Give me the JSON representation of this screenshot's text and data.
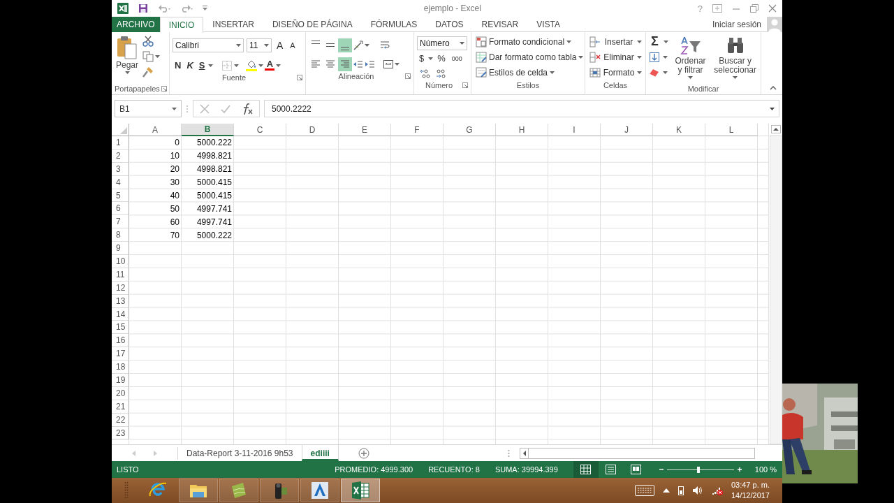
{
  "window": {
    "title": "ejemplo - Excel",
    "help": "?"
  },
  "tabs": [
    {
      "label": "ARCHIVO",
      "kind": "file",
      "selected": false
    },
    {
      "label": "INICIO",
      "kind": "tab",
      "selected": true
    },
    {
      "label": "INSERTAR",
      "kind": "tab",
      "selected": false
    },
    {
      "label": "DISEÑO DE PÁGINA",
      "kind": "tab",
      "selected": false
    },
    {
      "label": "FÓRMULAS",
      "kind": "tab",
      "selected": false
    },
    {
      "label": "DATOS",
      "kind": "tab",
      "selected": false
    },
    {
      "label": "REVISAR",
      "kind": "tab",
      "selected": false
    },
    {
      "label": "VISTA",
      "kind": "tab",
      "selected": false
    }
  ],
  "account": "Iniciar sesión",
  "ribbon": {
    "clipboard": {
      "paste": "Pegar",
      "label": "Portapapeles"
    },
    "font": {
      "name": "Calibri",
      "size": "11",
      "grow": "A",
      "shrink": "A",
      "styles": [
        "N",
        "K",
        "S"
      ],
      "color_button": "A",
      "label": "Fuente"
    },
    "alignment": {
      "vertical": [
        {
          "selected": false
        },
        {
          "selected": false
        },
        {
          "selected": true
        }
      ],
      "horizontal": [
        {
          "selected": false
        },
        {
          "selected": false
        },
        {
          "selected": true
        }
      ],
      "label": "Alineación"
    },
    "number": {
      "format": "Número",
      "currency": "$",
      "percent": "%",
      "thousands": "000",
      "label": "Número"
    },
    "styles": {
      "items": [
        "Formato condicional",
        "Dar formato como tabla",
        "Estilos de celda"
      ],
      "label": "Estilos"
    },
    "cells": {
      "items": [
        "Insertar",
        "Eliminar",
        "Formato"
      ],
      "label": "Celdas"
    },
    "editing": {
      "sum": "Σ",
      "sort": "Ordenar y filtrar",
      "find": "Buscar y seleccionar",
      "label": "Modificar"
    }
  },
  "formula_bar": {
    "name_box": "B1",
    "value": "5000.2222"
  },
  "grid": {
    "columns": [
      {
        "label": "A",
        "selected": false
      },
      {
        "label": "B",
        "selected": true
      },
      {
        "label": "C",
        "selected": false
      },
      {
        "label": "D",
        "selected": false
      },
      {
        "label": "E",
        "selected": false
      },
      {
        "label": "F",
        "selected": false
      },
      {
        "label": "G",
        "selected": false
      },
      {
        "label": "H",
        "selected": false
      },
      {
        "label": "I",
        "selected": false
      },
      {
        "label": "J",
        "selected": false
      },
      {
        "label": "K",
        "selected": false
      },
      {
        "label": "L",
        "selected": false
      }
    ],
    "rows": [
      {
        "number": "1",
        "cells": [
          "0",
          "5000.222"
        ]
      },
      {
        "number": "2",
        "cells": [
          "10",
          "4998.821"
        ]
      },
      {
        "number": "3",
        "cells": [
          "20",
          "4998.821"
        ]
      },
      {
        "number": "4",
        "cells": [
          "30",
          "5000.415"
        ]
      },
      {
        "number": "5",
        "cells": [
          "40",
          "5000.415"
        ]
      },
      {
        "number": "6",
        "cells": [
          "50",
          "4997.741"
        ]
      },
      {
        "number": "7",
        "cells": [
          "60",
          "4997.741"
        ]
      },
      {
        "number": "8",
        "cells": [
          "70",
          "5000.222"
        ]
      },
      {
        "number": "9"
      },
      {
        "number": "10"
      },
      {
        "number": "11"
      },
      {
        "number": "12"
      },
      {
        "number": "13"
      },
      {
        "number": "14"
      },
      {
        "number": "15"
      },
      {
        "number": "16"
      },
      {
        "number": "17"
      },
      {
        "number": "18"
      },
      {
        "number": "19"
      },
      {
        "number": "20"
      },
      {
        "number": "21"
      },
      {
        "number": "22"
      },
      {
        "number": "23"
      }
    ]
  },
  "sheets": [
    {
      "label": "Data-Report 3-11-2016 9h53",
      "selected": false
    },
    {
      "label": "ediiii",
      "selected": true
    }
  ],
  "status_bar": {
    "mode": "LISTO",
    "stats": [
      "PROMEDIO: 4999.300",
      "RECUENTO: 8",
      "SUMA: 39994.399"
    ],
    "views": [
      {
        "kind": "normal",
        "selected": true
      },
      {
        "kind": "layout",
        "selected": false
      },
      {
        "kind": "pagebreak",
        "selected": false
      }
    ],
    "zoom": {
      "level": 0.47,
      "reading": "100 %"
    }
  },
  "taskbar": {
    "apps": [
      {
        "kind": "ie",
        "selected": false
      },
      {
        "kind": "explorer",
        "selected": false
      },
      {
        "kind": "leaf",
        "selected": false
      },
      {
        "kind": "camera",
        "selected": false
      },
      {
        "kind": "cad",
        "selected": false
      },
      {
        "kind": "excel",
        "selected": true
      }
    ],
    "clock": {
      "time": "03:47 p. m.",
      "date": "14/12/2017"
    }
  }
}
